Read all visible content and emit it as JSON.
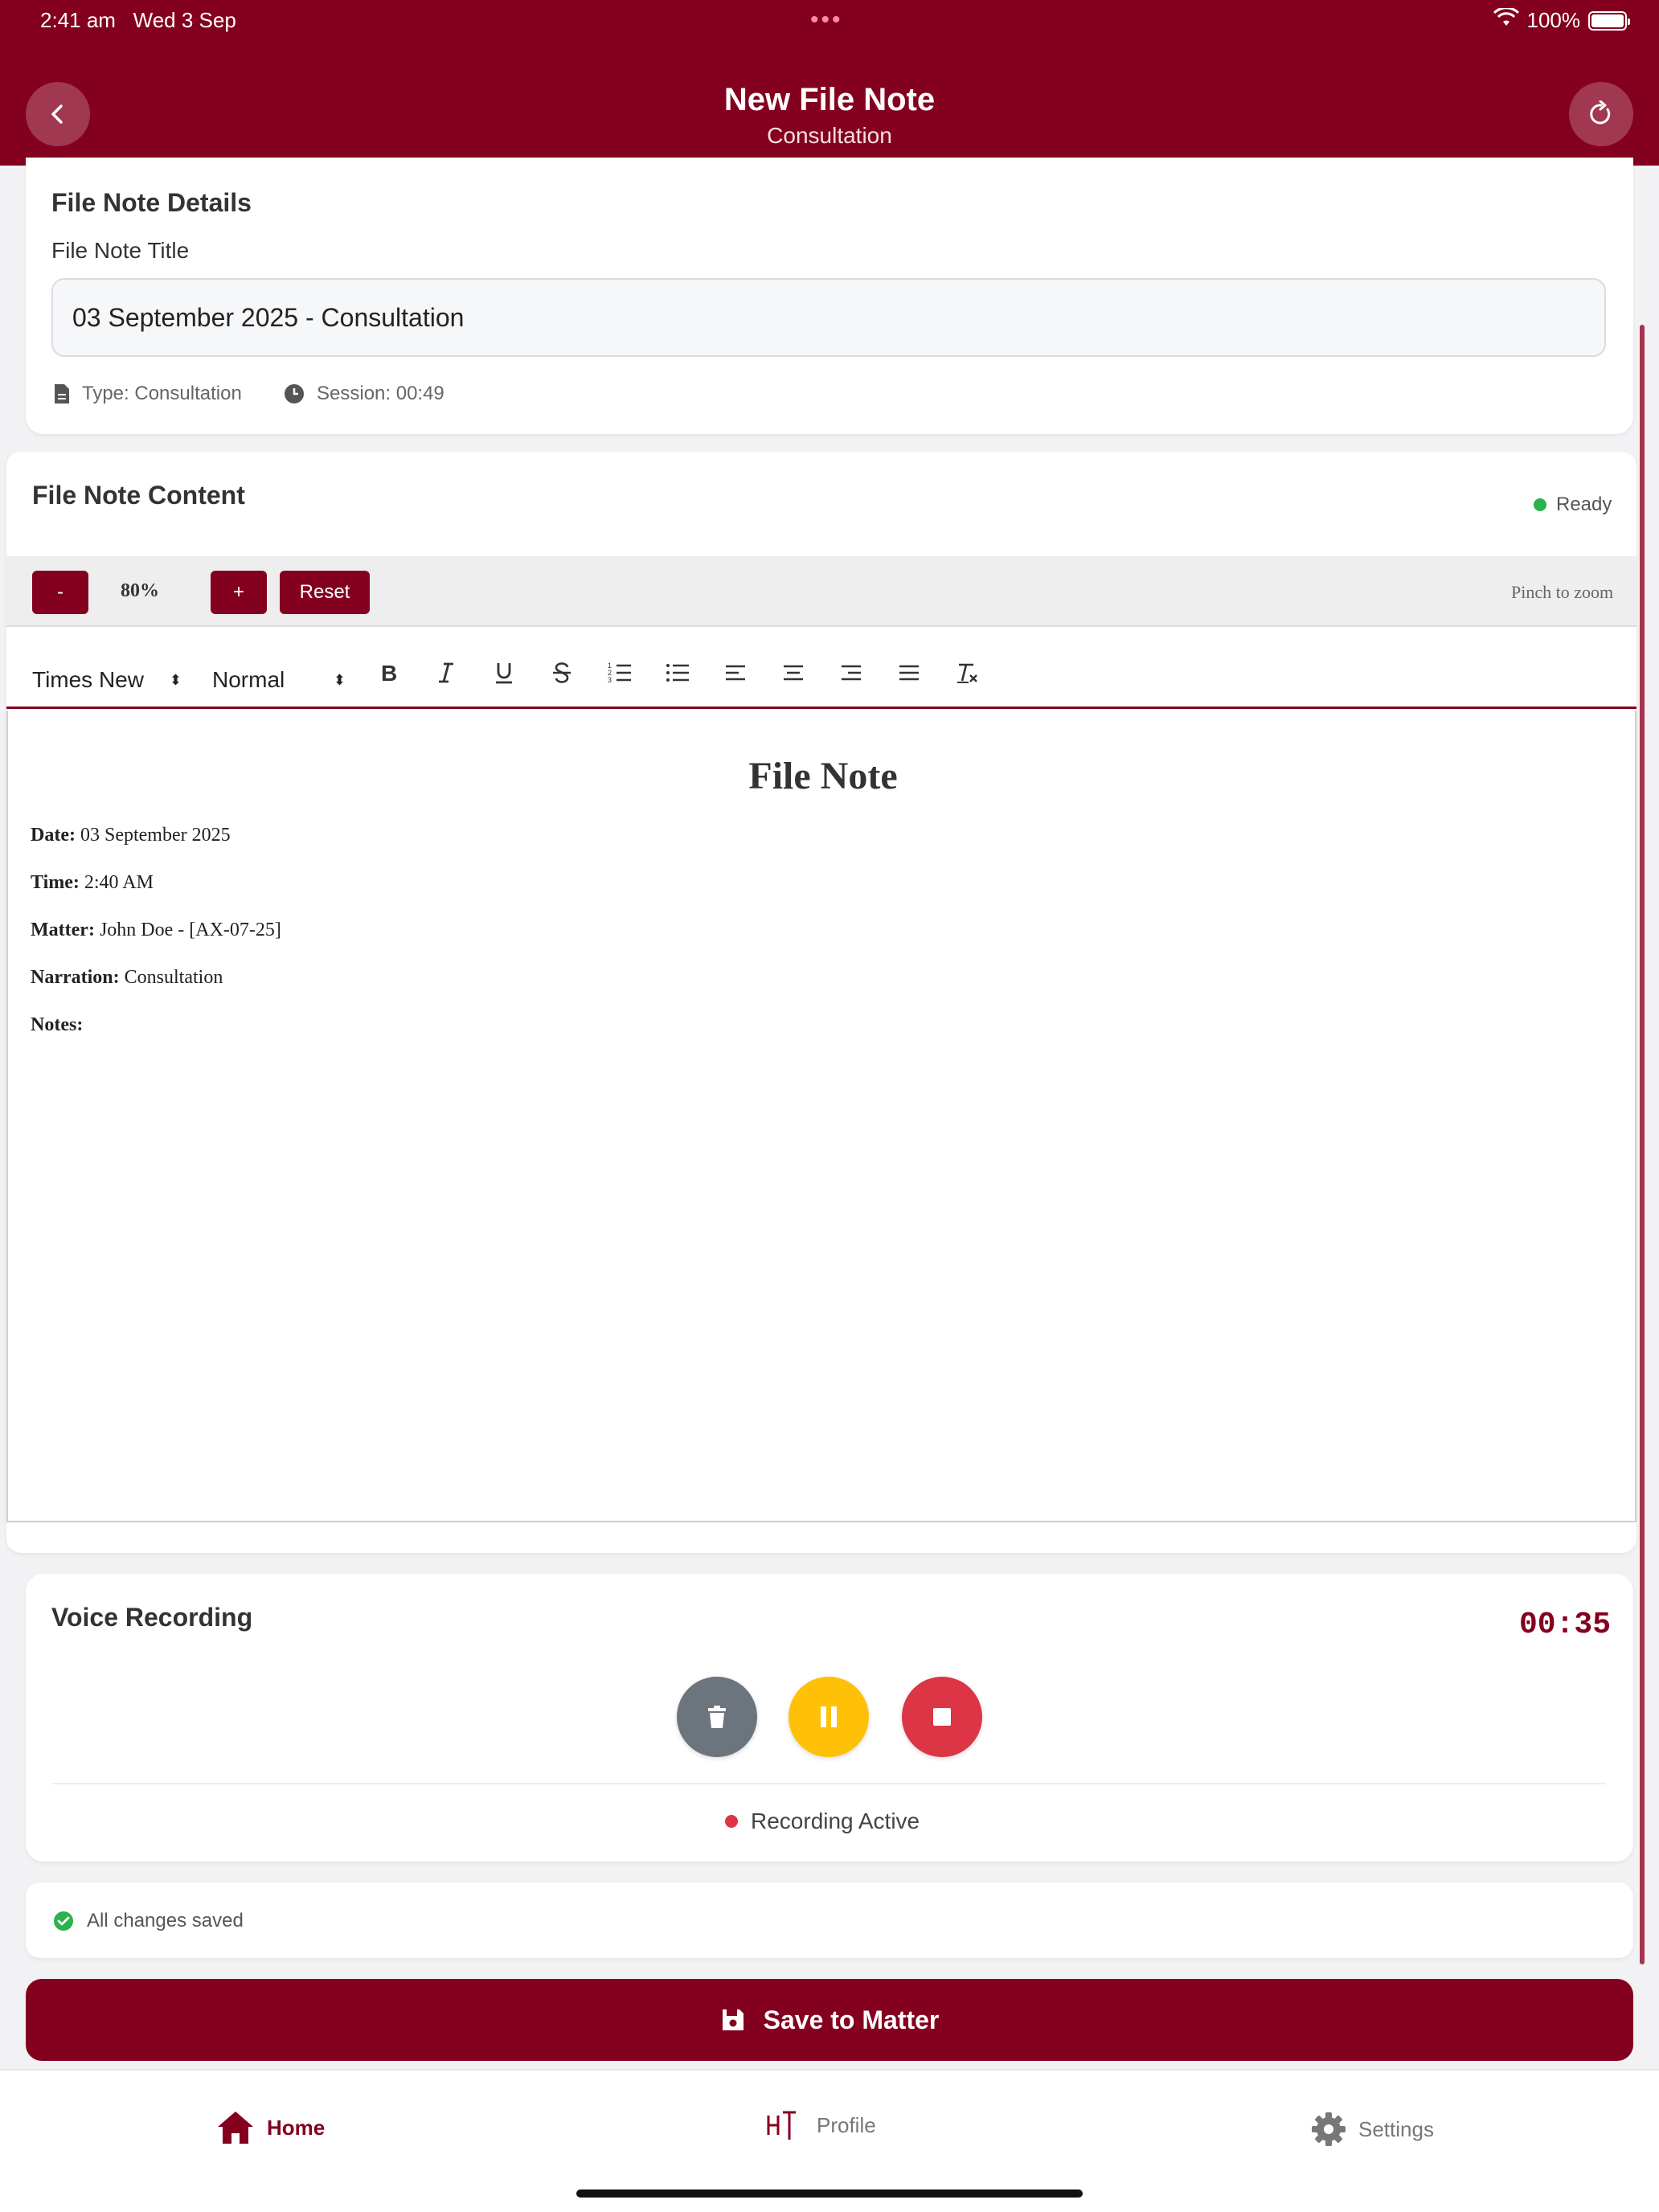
{
  "status_bar": {
    "time": "2:41 am",
    "date": "Wed 3 Sep",
    "battery": "100%"
  },
  "header": {
    "title": "New File Note",
    "subtitle": "Consultation"
  },
  "details": {
    "heading": "File Note Details",
    "title_label": "File Note Title",
    "title_value": "03 September 2025 - Consultation",
    "type_text": "Type: Consultation",
    "session_text": "Session: 00:49"
  },
  "content": {
    "heading": "File Note Content",
    "status": "Ready",
    "zoom": {
      "minus": "-",
      "level": "80%",
      "plus": "+",
      "reset": "Reset",
      "hint": "Pinch to zoom"
    },
    "toolbar": {
      "font": "Times New",
      "size": "Normal"
    },
    "document": {
      "title": "File Note",
      "lines": [
        {
          "label": "Date:",
          "value": " 03 September 2025"
        },
        {
          "label": "Time:",
          "value": " 2:40 AM"
        },
        {
          "label": "Matter:",
          "value": " John Doe - [AX-07-25]"
        },
        {
          "label": "Narration:",
          "value": " Consultation"
        },
        {
          "label": "Notes:",
          "value": ""
        }
      ]
    }
  },
  "recording": {
    "heading": "Voice Recording",
    "timer": "00:35",
    "status": "Recording Active"
  },
  "save_status": "All changes saved",
  "save_button": "Save to Matter",
  "tabs": [
    {
      "label": "Home",
      "icon": "home-icon",
      "active": true
    },
    {
      "label": "Profile",
      "icon": "profile-icon",
      "active": false
    },
    {
      "label": "Settings",
      "icon": "gear-icon",
      "active": false
    }
  ],
  "colors": {
    "brand": "#84001f",
    "ready": "#2bb24c",
    "pause": "#ffc107",
    "stop": "#dc3545",
    "delete": "#6c757d"
  }
}
